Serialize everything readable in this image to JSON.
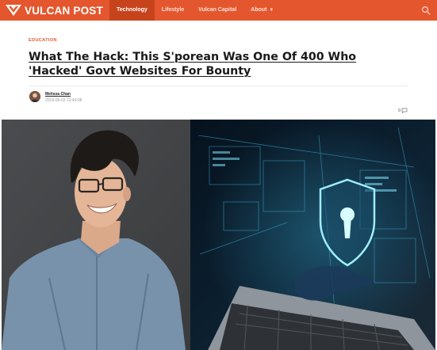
{
  "header": {
    "logo_text": "VULCAN POST",
    "brand_color": "#e4572e",
    "nav": [
      {
        "label": "Technology",
        "active": true
      },
      {
        "label": "Lifestyle",
        "active": false
      },
      {
        "label": "Vulcan Capital",
        "active": false
      },
      {
        "label": "About",
        "active": false,
        "dropdown": true
      }
    ],
    "search_icon": "search-icon"
  },
  "article": {
    "category": "EDUCATION",
    "title": "What The Hack: This S'porean Was One Of 400 Who 'Hacked' Govt Websites For Bounty",
    "author": "Melissa Chan",
    "date": "2019-05-03 13:49:08",
    "comment_count": "0"
  },
  "hero": {
    "icons": [
      "person-photo",
      "shield-keyhole-icon",
      "laptop"
    ]
  }
}
